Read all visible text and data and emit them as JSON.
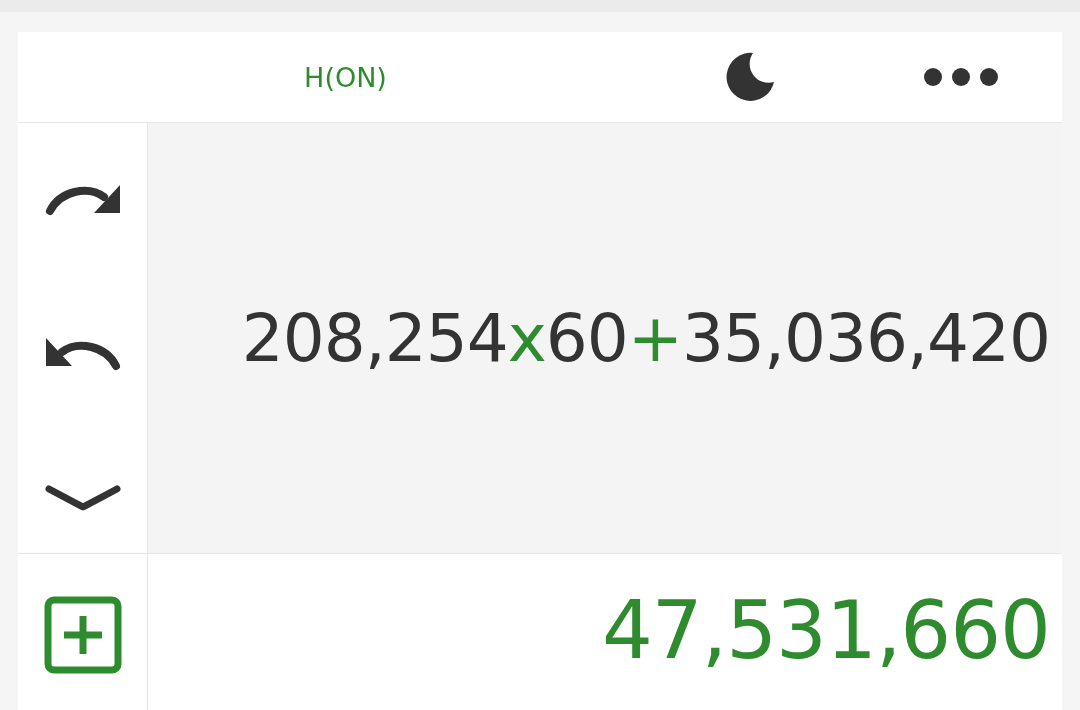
{
  "header": {
    "mode_label": "H(ON)"
  },
  "expression": [
    {
      "kind": "number",
      "text": "208,254"
    },
    {
      "kind": "operator",
      "text": "x"
    },
    {
      "kind": "number",
      "text": "60"
    },
    {
      "kind": "operator",
      "text": "+"
    },
    {
      "kind": "number",
      "text": "35,036,420"
    }
  ],
  "result": "47,531,660"
}
